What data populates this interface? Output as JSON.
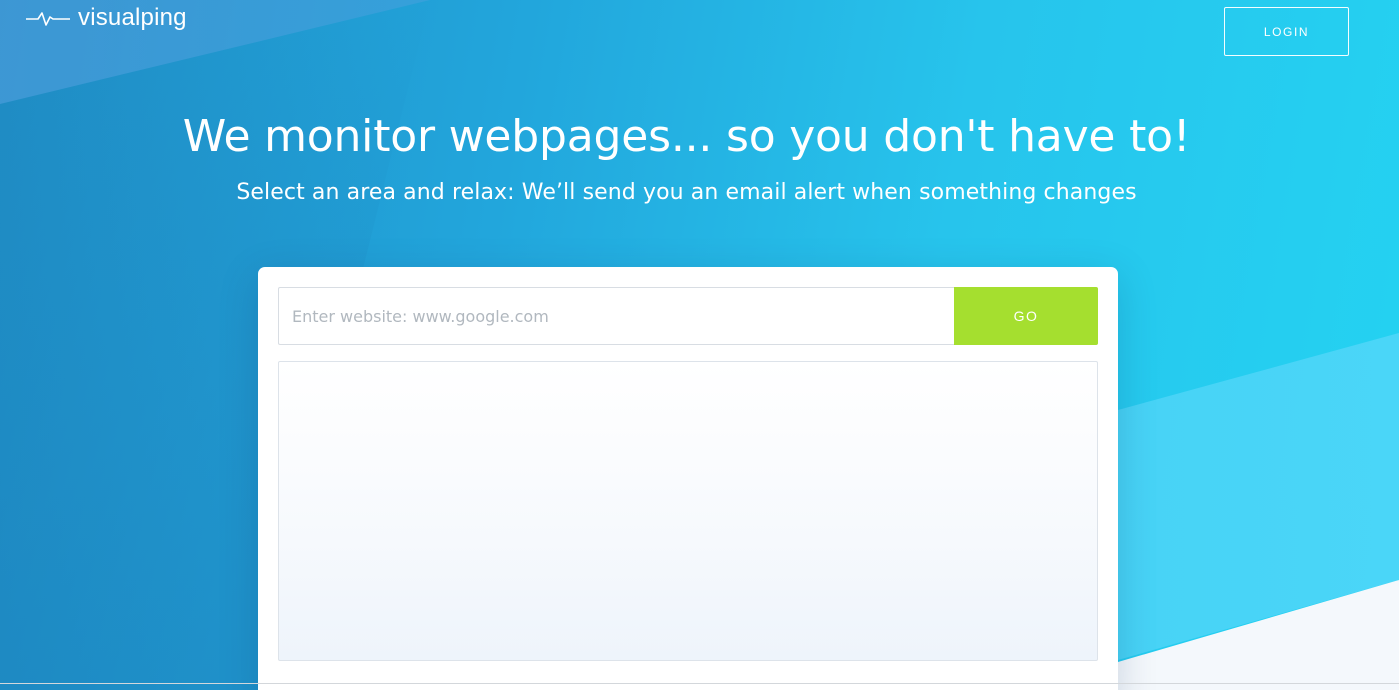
{
  "header": {
    "logo_text": "visualping",
    "logo_icon": "pulse-line-icon",
    "login_label": "LOGIN"
  },
  "hero": {
    "title": "We monitor webpages... so you don't have to!",
    "subtitle": "Select an area and relax: We’ll send you an email alert when something changes"
  },
  "form": {
    "url_placeholder": "Enter website: www.google.com",
    "url_value": "",
    "go_label": "GO"
  },
  "colors": {
    "accent_go": "#a5df2f",
    "background_start": "#1f8cc4",
    "background_end": "#24d3f2"
  }
}
